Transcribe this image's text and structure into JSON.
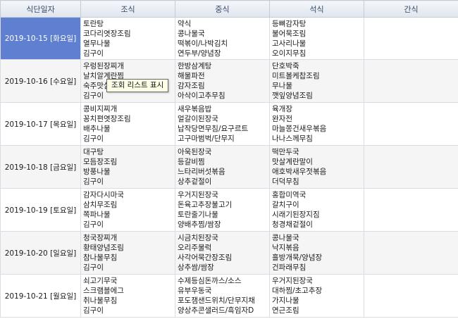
{
  "headers": [
    "식단일자",
    "조식",
    "중식",
    "석식",
    "간식"
  ],
  "tooltip": "조회 리스트 표시",
  "rows": [
    {
      "date": "2019-10-15 [화요일]",
      "breakfast": [
        "토란탕",
        "코다리엿장조림",
        "열무나물",
        "김구이"
      ],
      "lunch": [
        "약식",
        "콩나물국",
        "떡볶이/나박김치",
        "연두부/양념장"
      ],
      "dinner": [
        "등뼈감자탕",
        "불어묵조림",
        "고사리나물",
        "오이지무침"
      ],
      "snack": []
    },
    {
      "date": "2019-10-16 [수요일]",
      "breakfast": [
        "우렁된장찌개",
        "날치알계란찜",
        "숙주맛살",
        "김구이"
      ],
      "lunch": [
        "한방삼계탕",
        "해물파전",
        "감자조림",
        "아삭이고추무침"
      ],
      "dinner": [
        "단호박죽",
        "미트볼케찹조림",
        "무나물",
        "깻잎양념조림"
      ],
      "snack": []
    },
    {
      "date": "2019-10-17 [목요일]",
      "breakfast": [
        "콩비지찌개",
        "꽁치편엿장조림",
        "배추나물",
        "김구이"
      ],
      "lunch": [
        "새우볶음밥",
        "얼갈이된장국",
        "납작당면무침/요구르트",
        "고구마범벅/단무지"
      ],
      "dinner": [
        "육개장",
        "완자전",
        "마늘쫑건새우볶음",
        "나나스께무침"
      ],
      "snack": []
    },
    {
      "date": "2019-10-18 [금요일]",
      "breakfast": [
        "대구탕",
        "모듬장조림",
        "방풍나물",
        "김구이"
      ],
      "lunch": [
        "아욱된장국",
        "등갈비찜",
        "느타리버섯볶음",
        "상추겉절이"
      ],
      "dinner": [
        "떡만두국",
        "맛살계란말이",
        "애호박새우젓볶음",
        "더덕무침"
      ],
      "snack": []
    },
    {
      "date": "2019-10-19 [토요일]",
      "breakfast": [
        "감자다시마국",
        "삼치무조림",
        "쪽파나물",
        "김구이"
      ],
      "lunch": [
        "우거지된장국",
        "돈육고추장불고기",
        "토란줄기나물",
        "양배추찜/쌈장"
      ],
      "dinner": [
        "홍합미역국",
        "갈치구이",
        "시래기된장지짐",
        "청경채겉절이"
      ],
      "snack": []
    },
    {
      "date": "2019-10-20 [일요일]",
      "breakfast": [
        "청국장찌개",
        "황태양념조림",
        "참나물무침",
        "김구이"
      ],
      "lunch": [
        "시금치된장국",
        "오리주물럭",
        "사각어묵간장조림",
        "상추쌈/쌈장"
      ],
      "dinner": [
        "콩나물국",
        "낙지볶음",
        "흘방개묵/양념장",
        "건파래무침"
      ],
      "snack": []
    },
    {
      "date": "2019-10-21 [월요일]",
      "breakfast": [
        "쇠고기무국",
        "스크램블에그",
        "취나물무침",
        "김구이"
      ],
      "lunch": [
        "수제등심돈까스/소스",
        "유부우동국",
        "포도잼샌드위치/단무지채",
        "양상추콘샐러드/흑임자D"
      ],
      "dinner": [
        "우거지된장국",
        "대하찜/초고추장",
        "가지나물",
        "연근조림"
      ],
      "snack": []
    }
  ]
}
